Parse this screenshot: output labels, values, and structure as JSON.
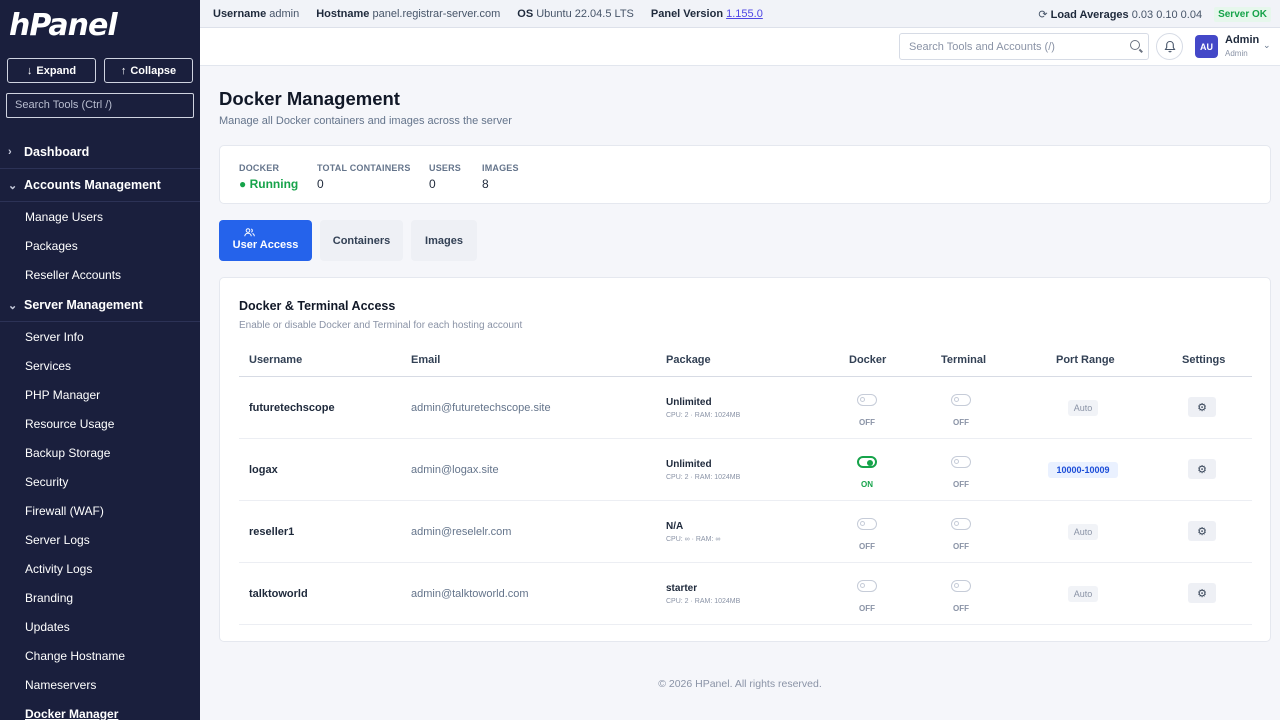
{
  "sidebar": {
    "logo": "hPanel",
    "expand_label": "Expand",
    "collapse_label": "Collapse",
    "search_placeholder": "Search Tools (Ctrl /)",
    "sections": [
      {
        "label": "Dashboard",
        "expanded": false,
        "items": []
      },
      {
        "label": "Accounts Management",
        "expanded": true,
        "items": [
          "Manage Users",
          "Packages",
          "Reseller Accounts"
        ]
      },
      {
        "label": "Server Management",
        "expanded": true,
        "items": [
          "Server Info",
          "Services",
          "PHP Manager",
          "Resource Usage",
          "Backup Storage",
          "Security",
          "Firewall (WAF)",
          "Server Logs",
          "Activity Logs",
          "Branding",
          "Updates",
          "Change Hostname",
          "Nameservers",
          "Docker Manager"
        ]
      }
    ],
    "active_item": "Docker Manager"
  },
  "topbar": {
    "username_label": "Username",
    "username": "admin",
    "hostname_label": "Hostname",
    "hostname": "panel.registrar-server.com",
    "os_label": "OS",
    "os": "Ubuntu 22.04.5 LTS",
    "version_label": "Panel Version",
    "version": "1.155.0",
    "load_label": "Load Averages",
    "load": "0.03 0.10 0.04",
    "status": "Server OK"
  },
  "header": {
    "search_placeholder": "Search Tools and Accounts (/)",
    "avatar_initials": "AU",
    "user_name": "Admin",
    "user_role": "Admin"
  },
  "page": {
    "title": "Docker Management",
    "subtitle": "Manage all Docker containers and images across the server"
  },
  "stats": [
    {
      "label": "DOCKER",
      "value": "● Running"
    },
    {
      "label": "TOTAL CONTAINERS",
      "value": "0"
    },
    {
      "label": "USERS",
      "value": "0"
    },
    {
      "label": "IMAGES",
      "value": "8"
    }
  ],
  "tabs": [
    {
      "label": "User Access",
      "active": true
    },
    {
      "label": "Containers",
      "active": false
    },
    {
      "label": "Images",
      "active": false
    }
  ],
  "card": {
    "title": "Docker & Terminal Access",
    "subtitle": "Enable or disable Docker and Terminal for each hosting account",
    "columns": [
      "Username",
      "Email",
      "Package",
      "Docker",
      "Terminal",
      "Port Range",
      "Settings"
    ],
    "rows": [
      {
        "username": "futuretechscope",
        "email": "admin@futuretechscope.site",
        "package": "Unlimited",
        "resources": "CPU: 2 · RAM: 1024MB",
        "docker": "OFF",
        "terminal": "OFF",
        "port_range": "Auto"
      },
      {
        "username": "logax",
        "email": "admin@logax.site",
        "package": "Unlimited",
        "resources": "CPU: 2 · RAM: 1024MB",
        "docker": "ON",
        "terminal": "OFF",
        "port_range": "10000-10009"
      },
      {
        "username": "reseller1",
        "email": "admin@reselelr.com",
        "package": "N/A",
        "resources": "CPU: ∞ · RAM: ∞",
        "docker": "OFF",
        "terminal": "OFF",
        "port_range": "Auto"
      },
      {
        "username": "talktoworld",
        "email": "admin@talktoworld.com",
        "package": "starter",
        "resources": "CPU: 2 · RAM: 1024MB",
        "docker": "OFF",
        "terminal": "OFF",
        "port_range": "Auto"
      }
    ]
  },
  "footer": "© 2026 HPanel. All rights reserved."
}
